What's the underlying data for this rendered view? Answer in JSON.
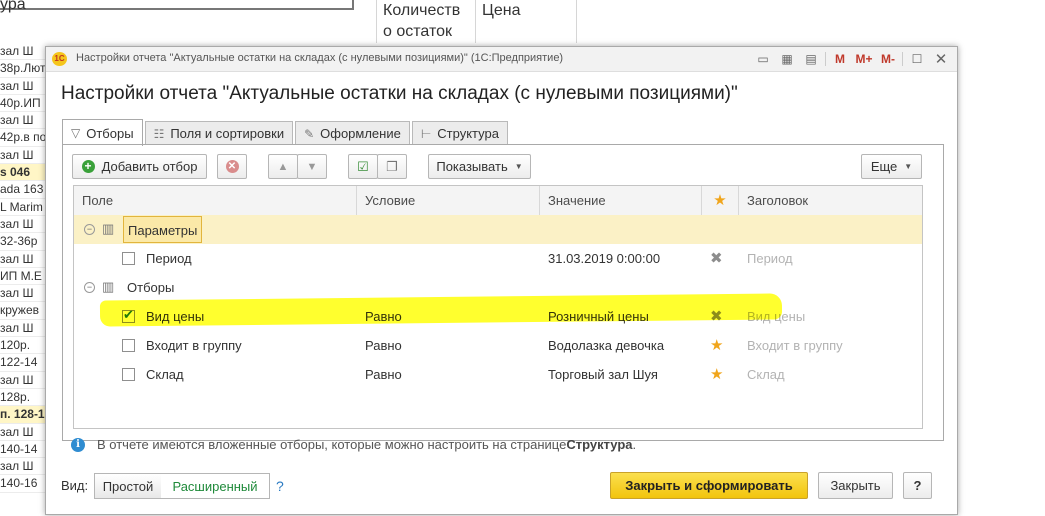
{
  "background": {
    "top_left_text": "ура",
    "col_qty_header": "Количеств\nо остаток",
    "col_price_header": "Цена",
    "left_rows": [
      "зал Ш",
      "38р.Лют",
      "зал Ш",
      "40р.ИП",
      "зал Ш",
      "42р.в по",
      "зал Ш",
      "s 046",
      "ada 163",
      "L Marim",
      "зал Ш",
      "32-36р",
      "зал Ш",
      "ИП М.Е",
      "зал Ш",
      "кружев",
      "зал Ш",
      "120р.",
      "122-14",
      "зал Ш",
      "128р.",
      "п. 128-1",
      "зал Ш",
      "140-14",
      "зал Ш",
      "140-16"
    ],
    "left_rows_highlight": [
      7,
      21
    ]
  },
  "window": {
    "title": "Настройки отчета \"Актуальные остатки на складах (с нулевыми позициями)\"  (1С:Предприятие)",
    "logo": "1С",
    "m_label": "M",
    "mplus_label": "M+",
    "mminus_label": "M-"
  },
  "dialog": {
    "title": "Настройки отчета \"Актуальные остатки на складах (с нулевыми позициями)\"",
    "tabs": [
      {
        "label": "Отборы",
        "icon": "funnel-icon",
        "active": true
      },
      {
        "label": "Поля и сортировки",
        "icon": "fields-icon",
        "active": false
      },
      {
        "label": "Оформление",
        "icon": "brush-icon",
        "active": false
      },
      {
        "label": "Структура",
        "icon": "structure-icon",
        "active": false
      }
    ],
    "toolbar": {
      "add_filter": "Добавить отбор",
      "show": "Показывать",
      "more": "Еще"
    },
    "grid": {
      "headers": {
        "field": "Поле",
        "condition": "Условие",
        "value": "Значение",
        "title": "Заголовок"
      },
      "groups": [
        {
          "label": "Параметры",
          "selected": true
        },
        {
          "label": "Отборы",
          "selected": false
        }
      ],
      "rows": [
        {
          "field": "Период",
          "condition": "",
          "value": "31.03.2019 0:00:00",
          "mark": "x",
          "title": "Период",
          "checked": false
        },
        {
          "field": "Вид цены",
          "condition": "Равно",
          "value": "Розничный цены",
          "mark": "x",
          "title": "Вид цены",
          "checked": true
        },
        {
          "field": "Входит в группу",
          "condition": "Равно",
          "value": "Водолазка девочка",
          "mark": "star",
          "title": "Входит в группу",
          "checked": false
        },
        {
          "field": "Склад",
          "condition": "Равно",
          "value": "Торговый зал Шуя",
          "mark": "star",
          "title": "Склад",
          "checked": false
        }
      ]
    },
    "info": {
      "text": "В отчете имеются вложенные отборы, которые можно настроить на странице ",
      "link": "Структура",
      "tail": "."
    },
    "footer": {
      "view_label": "Вид:",
      "simple": "Простой",
      "advanced": "Расширенный",
      "help": "?",
      "generate": "Закрыть и сформировать",
      "close": "Закрыть",
      "help_button": "?"
    }
  },
  "colors": {
    "accent_yellow": "#f2c40d",
    "star": "#f0a51c",
    "selected_row": "#fbf1c6",
    "link_green": "#1f8a3a",
    "highlight_marker": "#ffff00"
  }
}
